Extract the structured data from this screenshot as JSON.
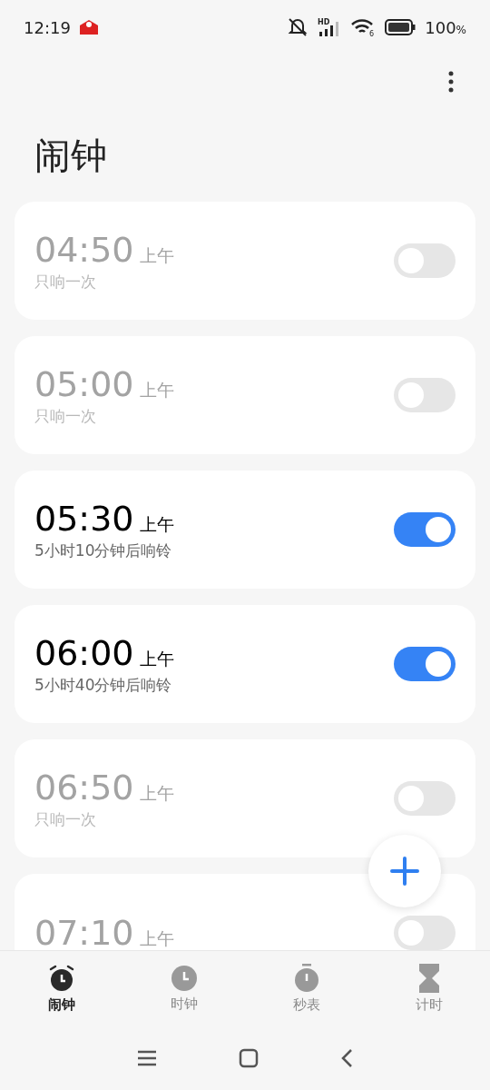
{
  "status_bar": {
    "time": "12:19",
    "battery": "100",
    "battery_unit": "%",
    "wifi_badge": "6",
    "signal_badge": "HD"
  },
  "title": "闹钟",
  "alarms": [
    {
      "time": "04:50",
      "period": "上午",
      "note": "只响一次",
      "on": false
    },
    {
      "time": "05:00",
      "period": "上午",
      "note": "只响一次",
      "on": false
    },
    {
      "time": "05:30",
      "period": "上午",
      "note": "5小时10分钟后响铃",
      "on": true
    },
    {
      "time": "06:00",
      "period": "上午",
      "note": "5小时40分钟后响铃",
      "on": true
    },
    {
      "time": "06:50",
      "period": "上午",
      "note": "只响一次",
      "on": false
    },
    {
      "time": "07:10",
      "period": "上午",
      "on": false
    }
  ],
  "tabs": [
    {
      "label": "闹钟",
      "kind": "alarm",
      "selected": true
    },
    {
      "label": "时钟",
      "kind": "clock",
      "selected": false
    },
    {
      "label": "秒表",
      "kind": "stopwatch",
      "selected": false
    },
    {
      "label": "计时",
      "kind": "timer",
      "selected": false
    }
  ]
}
